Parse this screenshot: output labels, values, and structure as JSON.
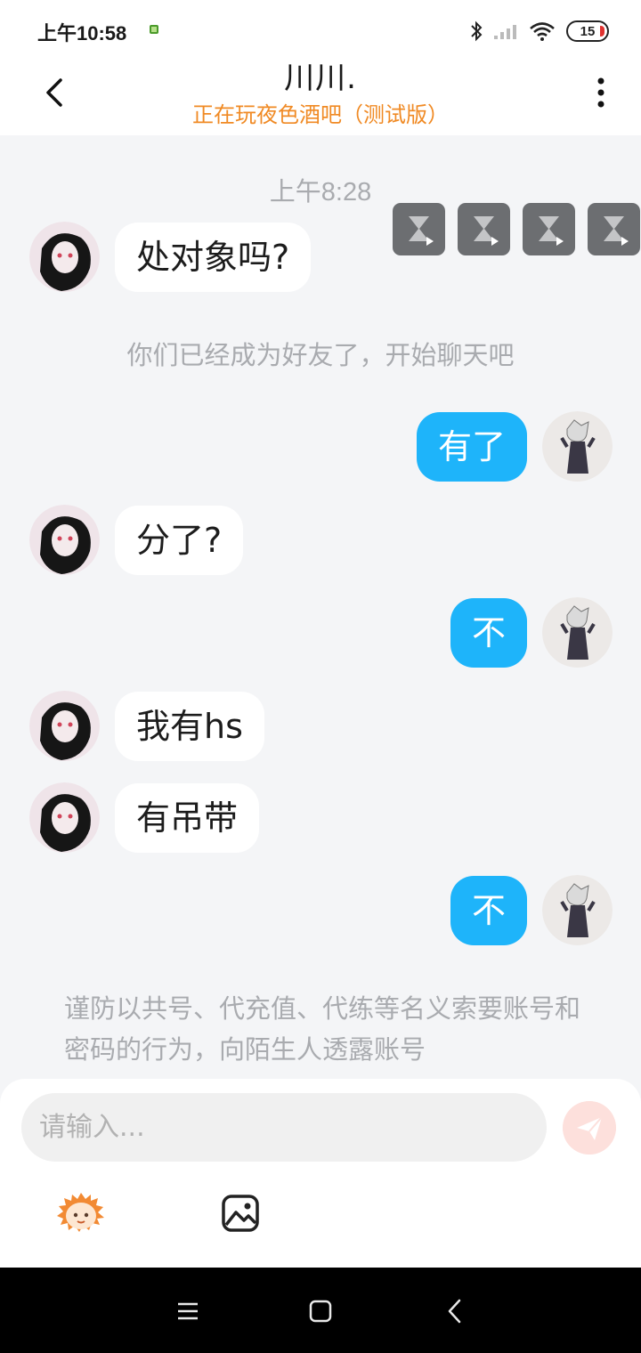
{
  "status_bar": {
    "time": "上午10:58",
    "battery": "15",
    "icons": [
      "bluetooth-icon",
      "signal-icon",
      "wifi-icon",
      "battery-icon"
    ]
  },
  "header": {
    "title": "川川.",
    "subtitle": "正在玩夜色酒吧（测试版）"
  },
  "chat": {
    "timestamp": "上午8:28",
    "system_message": "你们已经成为好友了，开始聊天吧",
    "messages": [
      {
        "side": "left",
        "text": "处对象吗?"
      },
      {
        "side": "right",
        "text": "有了"
      },
      {
        "side": "left",
        "text": "分了?"
      },
      {
        "side": "right",
        "text": "不"
      },
      {
        "side": "left",
        "text": "我有hs"
      },
      {
        "side": "left",
        "text": "有吊带"
      },
      {
        "side": "right",
        "text": "不"
      }
    ],
    "warning": "谨防以共号、代充值、代练等名义索要账号和密码的行为，向陌生人透露账号"
  },
  "input": {
    "placeholder": "请输入..."
  },
  "colors": {
    "accent": "#1eb4fa",
    "subtitle": "#f08a24",
    "background": "#f4f5f7"
  }
}
